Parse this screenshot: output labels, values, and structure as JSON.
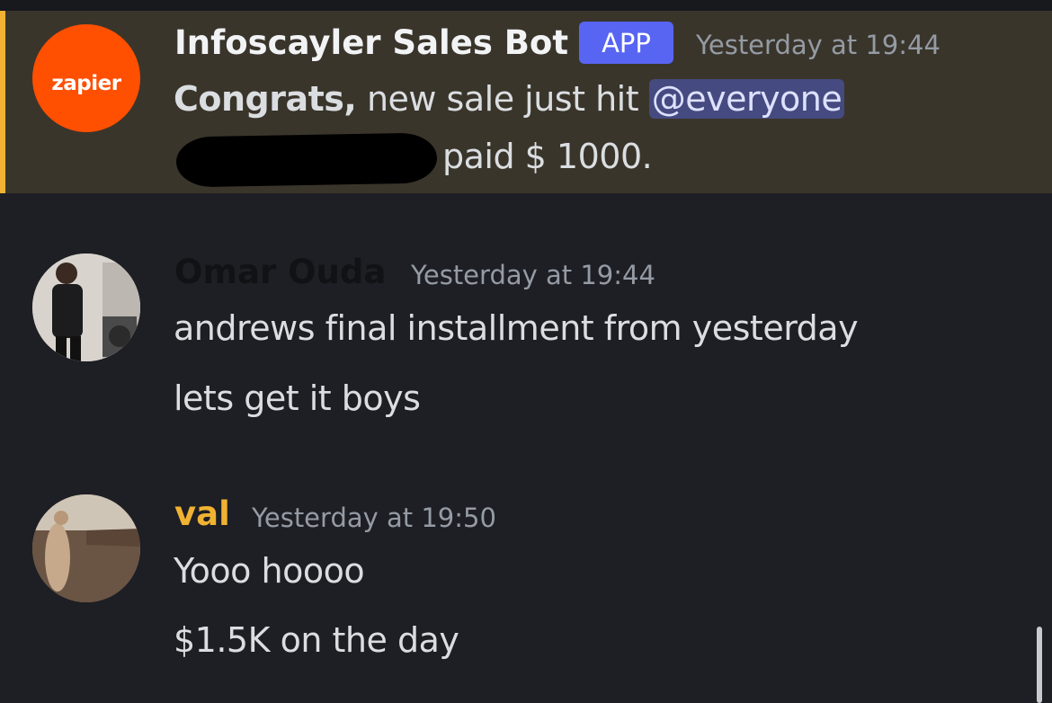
{
  "messages": [
    {
      "author": "Infoscayler Sales Bot",
      "badge": "APP",
      "timestamp": "Yesterday at 19:44",
      "avatar_text": "zapier",
      "line1_bold": "Congrats,",
      "line1_text": " new sale just hit ",
      "mention": "@everyone",
      "line2_text": "paid $ 1000.",
      "accent_color": "#f0b232"
    },
    {
      "author": "Omar Ouda",
      "timestamp": "Yesterday at 19:44",
      "lines": [
        "andrews final installment from yesterday",
        "lets get it boys"
      ]
    },
    {
      "author": "val",
      "author_color": "#f0b232",
      "timestamp": "Yesterday at 19:50",
      "lines": [
        "Yooo hoooo",
        "$1.5K on the day"
      ]
    }
  ]
}
